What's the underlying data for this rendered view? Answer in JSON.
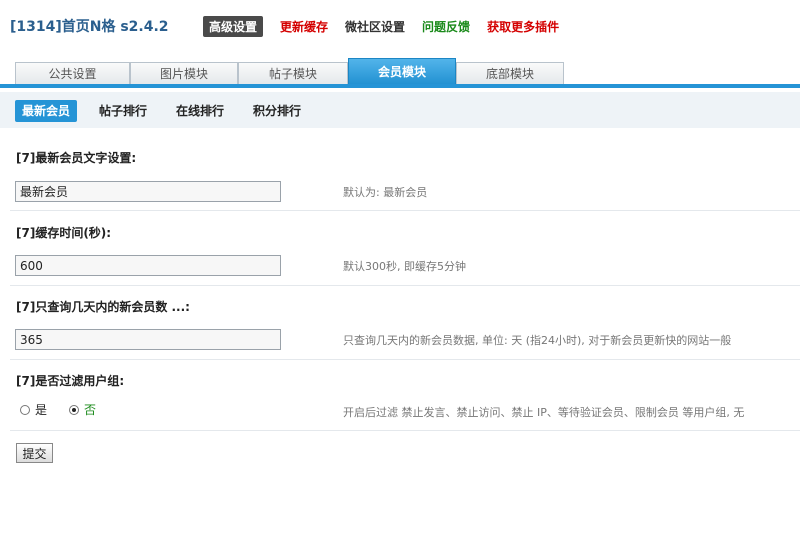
{
  "header": {
    "app_title": "[1314]首页N格 s2.4.2",
    "nav": [
      {
        "label": "高级设置"
      },
      {
        "label": "更新缓存"
      },
      {
        "label": "微社区设置"
      },
      {
        "label": "问题反馈"
      },
      {
        "label": "获取更多插件"
      }
    ]
  },
  "tabs": [
    {
      "label": "公共设置"
    },
    {
      "label": "图片模块"
    },
    {
      "label": "帖子模块"
    },
    {
      "label": "会员模块"
    },
    {
      "label": "底部模块"
    }
  ],
  "subtabs": [
    {
      "label": "最新会员"
    },
    {
      "label": "帖子排行"
    },
    {
      "label": "在线排行"
    },
    {
      "label": "积分排行"
    }
  ],
  "fields": [
    {
      "label": "[7]最新会员文字设置:",
      "value": "最新会员",
      "hint": "默认为: 最新会员"
    },
    {
      "label": "[7]缓存时间(秒):",
      "value": "600",
      "hint": "默认300秒, 即缓存5分钟"
    },
    {
      "label": "[7]只查询几天内的新会员数 ...:",
      "value": "365",
      "hint": "只查询几天内的新会员数据, 单位: 天 (指24小时), 对于新会员更新快的网站一般"
    },
    {
      "label": "[7]是否过滤用户组:",
      "hint": "开启后过滤 禁止发言、禁止访问、禁止 IP、等待验证会员、限制会员 等用户组, 无"
    }
  ],
  "radio": {
    "options": [
      "是",
      "否"
    ],
    "selected": "否"
  },
  "submit_label": "提交",
  "colors": {
    "accent": "#2594d6",
    "nav_red": "#d40000",
    "nav_green": "#1a8a1a",
    "title": "#2b5f8e"
  }
}
